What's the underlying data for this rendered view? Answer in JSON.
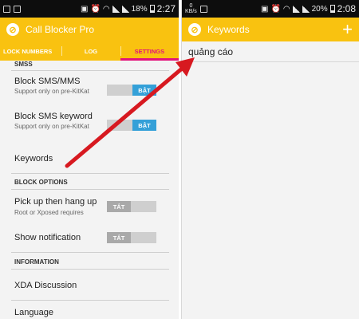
{
  "left_status": {
    "time": "2:27",
    "battery": "18%"
  },
  "right_status": {
    "time": "2:08",
    "battery": "20%",
    "data_speed_value": "0",
    "data_speed_unit": "KB/s"
  },
  "left_app": {
    "title": "Call Blocker Pro",
    "tabs": [
      "LOCK NUMBERS",
      "LOG",
      "SETTINGS"
    ],
    "active_tab": "SETTINGS"
  },
  "settings": {
    "sms_header": "SMSS",
    "block_sms_title": "Block SMS/MMS",
    "block_sms_sub": "Support only on pre-KitKat",
    "block_sms_toggle": "BẬT",
    "block_keyword_title": "Block SMS keyword",
    "block_keyword_sub": "Support only on pre-KitKat",
    "block_keyword_toggle": "BẬT",
    "keywords_title": "Keywords",
    "block_options_header": "BLOCK OPTIONS",
    "pickup_title": "Pick up then hang up",
    "pickup_sub": "Root or Xposed requires",
    "pickup_toggle": "TẮT",
    "notification_title": "Show notification",
    "notification_toggle": "TẮT",
    "information_header": "INFORMATION",
    "xda_title": "XDA Discussion",
    "language_title": "Language"
  },
  "right_app": {
    "title": "Keywords",
    "add_label": "+",
    "keywords": [
      "quảng cáo"
    ]
  },
  "colors": {
    "app_bar": "#f9c210",
    "active_tab": "#e2137a",
    "toggle_on": "#34a0d8",
    "arrow": "#d71920"
  },
  "icons": {
    "app_logo": "block-circle-icon",
    "add": "plus-icon",
    "arrow": "red-arrow-icon"
  }
}
